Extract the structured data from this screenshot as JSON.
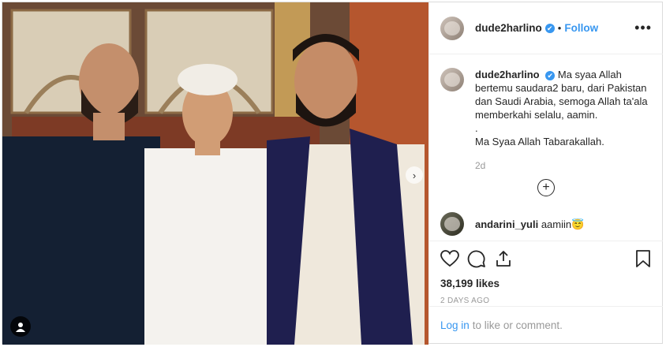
{
  "post": {
    "username": "dude2harlino",
    "verified_mark": "✔",
    "separator": "•",
    "follow_label": "Follow",
    "more_label": "•••",
    "caption": "Ma syaa Allah bertemu saudara2 baru, dari Pakistan dan Saudi Arabia, semoga Allah ta'ala memberkahi selalu, aamin.",
    "caption_break": ".",
    "caption_line2": "Ma Syaa Allah Tabarakallah.",
    "caption_time": "2d",
    "load_more": "+",
    "comments": [
      {
        "username": "andarini_yuli",
        "text": "aamiin😇"
      }
    ],
    "likes": "38,199 likes",
    "date": "2 DAYS AGO",
    "login_link": "Log in",
    "login_text": "to like or comment."
  },
  "colors": {
    "link_blue": "#3897f0",
    "text": "#262626",
    "muted": "#999999",
    "border": "#efefef"
  },
  "icons": [
    "user-tag-icon",
    "next-arrow-icon",
    "heart-icon",
    "comment-icon",
    "share-icon",
    "bookmark-icon",
    "more-options-icon",
    "plus-circle-icon",
    "verified-badge-icon"
  ]
}
